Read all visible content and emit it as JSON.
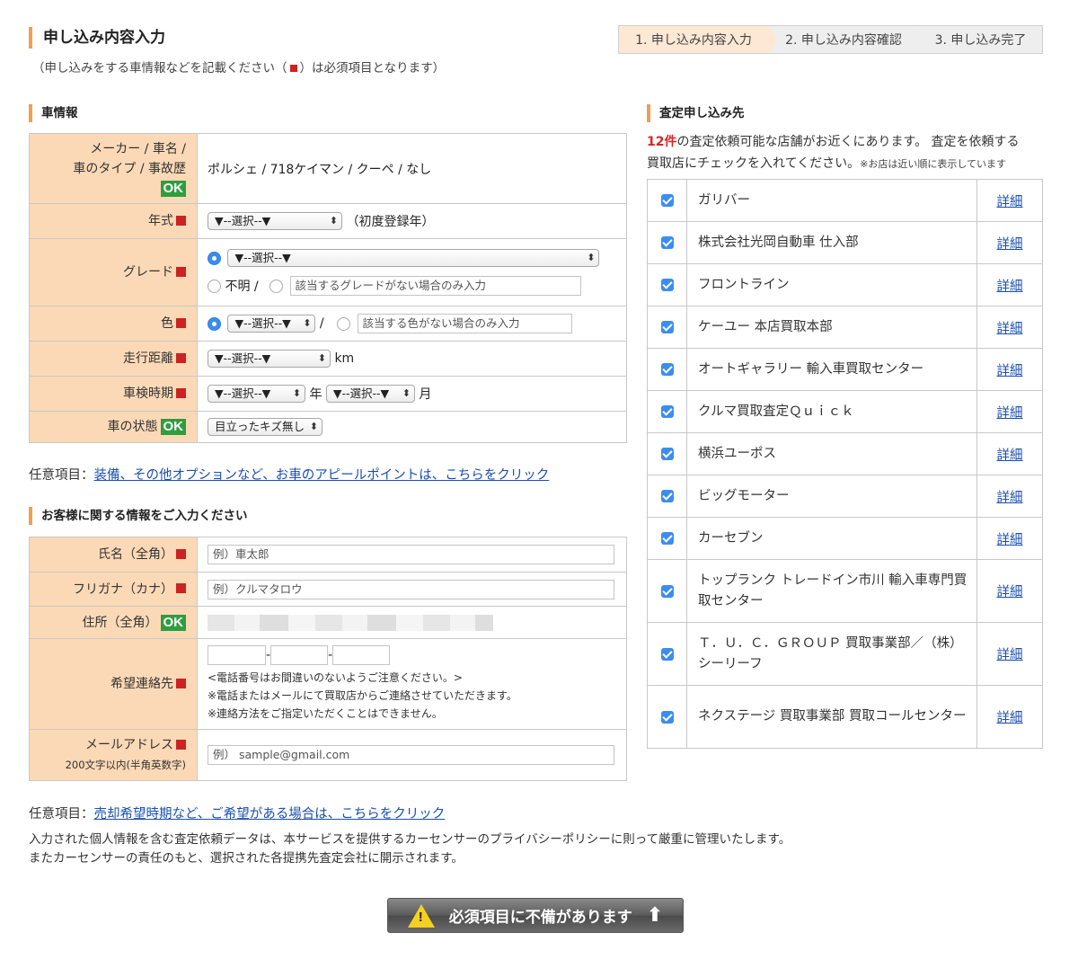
{
  "header": {
    "title": "申し込み内容入力",
    "subtitle_before": "（申し込みをする車情報などを記載ください（",
    "subtitle_after": "）は必須項目となります）",
    "steps": [
      "1. 申し込み内容入力",
      "2. 申し込み内容確認",
      "3. 申し込み完了"
    ]
  },
  "car": {
    "heading": "車情報",
    "maker_label_1": "メーカー / 車名 /",
    "maker_label_2": "車のタイプ / 事故歴",
    "maker_value": "ポルシェ / 718ケイマン / クーペ / なし",
    "year_label": "年式",
    "year_select": "▼--選択--▼",
    "year_note": "（初度登録年）",
    "grade_label": "グレード",
    "grade_select": "▼--選択--▼",
    "grade_unknown": "不明 /",
    "grade_placeholder": "該当するグレードがない場合のみ入力",
    "color_label": "色",
    "color_select": "▼--選択--▼",
    "color_slash": "/",
    "color_placeholder": "該当する色がない場合のみ入力",
    "mileage_label": "走行距離",
    "mileage_select": "▼--選択--▼",
    "mileage_unit": "km",
    "inspection_label": "車検時期",
    "inspection_year_select": "▼--選択--▼",
    "inspection_year_unit": "年",
    "inspection_month_select": "▼--選択--▼",
    "inspection_month_unit": "月",
    "condition_label": "車の状態",
    "condition_select": "目立ったキズ無し",
    "ok": "OK"
  },
  "optional1": {
    "prefix": "任意項目：",
    "link": "装備、その他オプションなど、お車のアピールポイントは、こちらをクリック"
  },
  "customer": {
    "heading": "お客様に関する情報をご入力ください",
    "name_label": "氏名（全角）",
    "name_placeholder": "例）車太郎",
    "kana_label": "フリガナ（カナ）",
    "kana_placeholder": "例）クルマタロウ",
    "address_label": "住所（全角）",
    "phone_label": "希望連絡先",
    "phone_note_1": "<電話番号はお間違いのないようご注意ください。>",
    "phone_note_2": "※電話またはメールにて買取店からご連絡させていただきます。",
    "phone_note_3": "※連絡方法をご指定いただくことはできません。",
    "phone_dash": "-",
    "email_label": "メールアドレス",
    "email_sublabel": "200文字以内(半角英数字)",
    "email_placeholder": "例） sample@gmail.com"
  },
  "optional2": {
    "prefix": "任意項目：",
    "link": "売却希望時期など、ご希望がある場合は、こちらをクリック"
  },
  "privacy": {
    "line1": "入力された個人情報を含む査定依頼データは、本サービスを提供するカーセンサーのプライバシーポリシーに則って厳重に管理いたします。",
    "line2": "またカーセンサーの責任のもと、選択された各提携先査定会社に開示されます。"
  },
  "shops": {
    "heading": "査定申し込み先",
    "count": "12件",
    "intro_1": "の査定依頼可能な店舗がお近くにあります。 査定を依頼する",
    "intro_2": "買取店にチェックを入れてください。",
    "intro_small": "※お店は近い順に表示しています",
    "detail_label": "詳細",
    "items": [
      {
        "name": "ガリバー"
      },
      {
        "name": "株式会社光岡自動車 仕入部"
      },
      {
        "name": "フロントライン"
      },
      {
        "name": "ケーユー 本店買取本部"
      },
      {
        "name": "オートギャラリー 輸入車買取センター"
      },
      {
        "name": "クルマ買取査定Ｑｕｉｃｋ"
      },
      {
        "name": "横浜ユーポス"
      },
      {
        "name": "ビッグモーター"
      },
      {
        "name": "カーセブン"
      },
      {
        "name": "トップランク トレードイン市川 輸入車専門買取センター"
      },
      {
        "name": "Ｔ．Ｕ．Ｃ．ＧＲＯＵＰ 買取事業部／（株）シーリーフ"
      },
      {
        "name": "ネクステージ 買取事業部 買取コールセンター"
      }
    ]
  },
  "submit": {
    "label": "必須項目に不備があります",
    "warn_glyph": "!"
  },
  "colors": {
    "accent": "#f0a050",
    "label_bg": "#fbd9b6",
    "required": "#cc2222",
    "ok": "#2e9e3e",
    "link": "#1a4fb0",
    "count": "#dd2222"
  },
  "icons": {
    "warning": "warning-icon",
    "arrow": "arrow-up-icon",
    "checkbox": "checkbox-checked-icon"
  }
}
